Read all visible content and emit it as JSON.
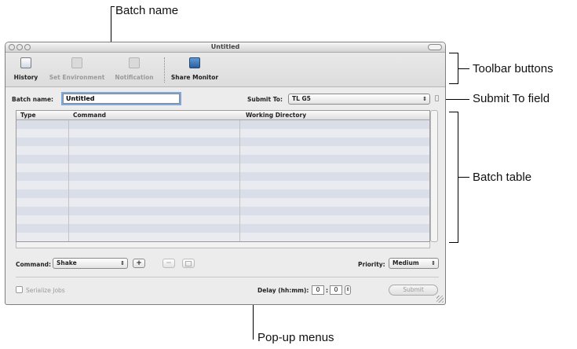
{
  "callouts": {
    "batch_name": "Batch name",
    "toolbar_buttons": "Toolbar buttons",
    "submit_to_field": "Submit To field",
    "batch_table": "Batch table",
    "popup_menus": "Pop-up menus"
  },
  "window": {
    "title": "Untitled"
  },
  "toolbar": {
    "history": "History",
    "set_environment": "Set Environment",
    "notification": "Notification",
    "share_monitor": "Share Monitor"
  },
  "batch": {
    "label": "Batch name:",
    "value": "Untitled"
  },
  "submit_to": {
    "label": "Submit To:",
    "value": "TL G5"
  },
  "table": {
    "columns": [
      "Type",
      "Command",
      "Working Directory"
    ],
    "rows": []
  },
  "command": {
    "label": "Command:",
    "value": "Shake",
    "add": "+",
    "remove": "−"
  },
  "priority": {
    "label": "Priority:",
    "value": "Medium"
  },
  "serialize": {
    "label": "Serialize Jobs",
    "checked": false
  },
  "delay": {
    "label": "Delay (hh:mm):",
    "hours": "0",
    "minutes": "0",
    "separator": ":"
  },
  "submit_button": "Submit"
}
